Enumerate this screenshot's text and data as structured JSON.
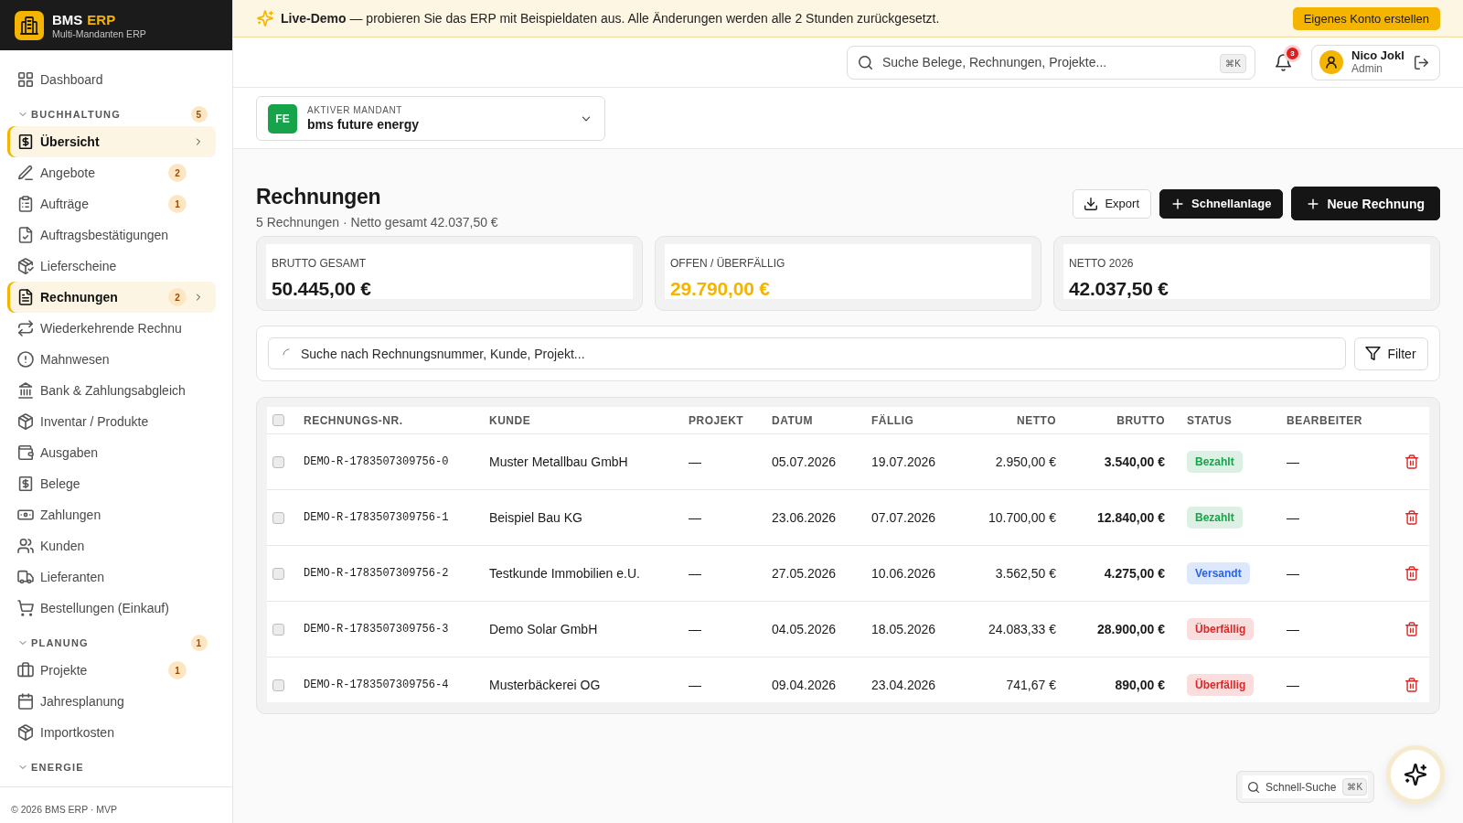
{
  "banner": {
    "message": "**Live-Demo** — probieren Sie das ERP mit Beispieldaten aus. Alle Änderungen werden alle 2 Stunden zurückgesetzt.",
    "button": "Eigenes Konto erstellen"
  },
  "sidebar": {
    "brand": {
      "name": "BMS",
      "accent": "ERP",
      "subtitle": "Multi-Mandanten ERP"
    },
    "nav": [
      {
        "kind": "item",
        "label": "Dashboard",
        "selected": false
      },
      {
        "kind": "section",
        "label": "BUCHHALTUNG",
        "badge": "5",
        "expanded": true,
        "children": [
          {
            "label": "Übersicht",
            "selected": true
          },
          {
            "label": "Angebote",
            "badge": "2",
            "selected": false
          },
          {
            "label": "Aufträge",
            "badge": "1",
            "selected": false
          },
          {
            "label": "Auftragsbestätigungen",
            "selected": false
          },
          {
            "label": "Lieferscheine",
            "selected": false
          },
          {
            "label": "Rechnungen",
            "badge": "2",
            "selected": true
          },
          {
            "label": "Wiederkehrende Rechnu",
            "selected": false
          },
          {
            "label": "Mahnwesen",
            "selected": false
          },
          {
            "label": "Bank & Zahlungsabgleich",
            "selected": false
          },
          {
            "label": "Inventar / Produkte",
            "selected": false
          },
          {
            "label": "Ausgaben",
            "selected": false
          },
          {
            "label": "Belege",
            "selected": false
          },
          {
            "label": "Zahlungen",
            "selected": false
          },
          {
            "label": "Kunden",
            "selected": false
          },
          {
            "label": "Lieferanten",
            "selected": false
          },
          {
            "label": "Bestellungen (Einkauf)",
            "selected": false
          }
        ]
      },
      {
        "kind": "section",
        "label": "PLANUNG",
        "badge": "1",
        "expanded": true,
        "children": [
          {
            "label": "Projekte",
            "badge": "1",
            "selected": false
          },
          {
            "label": "Jahresplanung",
            "selected": false
          },
          {
            "label": "Importkosten",
            "selected": false
          }
        ]
      },
      {
        "kind": "section",
        "label": "ENERGIE",
        "expanded": true
      }
    ],
    "footer": "© 2026 BMS ERP · MVP"
  },
  "topbar": {
    "search": {
      "placeholder": "Suche Belege, Rechnungen, Projekte...",
      "shortcut": "⌘K"
    },
    "notifications": {
      "count": "3"
    },
    "user": {
      "name": "Nico Jokl",
      "role": "Admin"
    }
  },
  "mandant": {
    "initials": "FE",
    "label": "AKTIVER MANDANT",
    "name": "bms future energy"
  },
  "page": {
    "title": "Rechnungen",
    "subtitle": "5 Rechnungen · Netto gesamt 42.037,50 €",
    "actions": [
      {
        "kind": "outline",
        "label": "Export"
      },
      {
        "kind": "dark",
        "label": "Schnellanlage"
      },
      {
        "kind": "primary",
        "label": "Neue Rechnung"
      }
    ]
  },
  "stats": [
    {
      "label": "BRUTTO GESAMT",
      "value": "50.445,00 €",
      "kind": "default"
    },
    {
      "label": "OFFEN / ÜBERFÄLLIG",
      "value": "29.790,00 €",
      "kind": "warning"
    },
    {
      "label": "NETTO 2026",
      "value": "42.037,50 €",
      "kind": "default"
    }
  ],
  "filter": {
    "search": {
      "placeholder": "Suche nach Rechnungsnummer, Kunde, Projekt..."
    },
    "button": "Filter"
  },
  "table": {
    "select_all": {
      "checked": false
    },
    "columns": [
      "RECHNUNGS-NR.",
      "KUNDE",
      "PROJEKT",
      "DATUM",
      "FÄLLIG",
      "NETTO",
      "BRUTTO",
      "STATUS",
      "BEARBEITER"
    ],
    "rows": [
      {
        "checked": false,
        "number": "DEMO-R-1783507309756-0",
        "customer": "Muster Metallbau GmbH",
        "project": "—",
        "date": "05.07.2026",
        "due": "19.07.2026",
        "net": "2.950,00 €",
        "gross": "3.540,00 €",
        "status": {
          "label": "Bezahlt",
          "color": "#16a34a"
        },
        "editor": "—"
      },
      {
        "checked": false,
        "number": "DEMO-R-1783507309756-1",
        "customer": "Beispiel Bau KG",
        "project": "—",
        "date": "23.06.2026",
        "due": "07.07.2026",
        "net": "10.700,00 €",
        "gross": "12.840,00 €",
        "status": {
          "label": "Bezahlt",
          "color": "#16a34a"
        },
        "editor": "—"
      },
      {
        "checked": false,
        "number": "DEMO-R-1783507309756-2",
        "customer": "Testkunde Immobilien e.U.",
        "project": "—",
        "date": "27.05.2026",
        "due": "10.06.2026",
        "net": "3.562,50 €",
        "gross": "4.275,00 €",
        "status": {
          "label": "Versandt",
          "color": "#2563eb"
        },
        "editor": "—"
      },
      {
        "checked": false,
        "number": "DEMO-R-1783507309756-3",
        "customer": "Demo Solar GmbH",
        "project": "—",
        "date": "04.05.2026",
        "due": "18.05.2026",
        "net": "24.083,33 €",
        "gross": "28.900,00 €",
        "status": {
          "label": "Überfällig",
          "color": "#dc2626"
        },
        "editor": "—"
      },
      {
        "checked": false,
        "number": "DEMO-R-1783507309756-4",
        "customer": "Musterbäckerei OG",
        "project": "—",
        "date": "09.04.2026",
        "due": "23.04.2026",
        "net": "741,67 €",
        "gross": "890,00 €",
        "status": {
          "label": "Überfällig",
          "color": "#dc2626"
        },
        "editor": "—"
      }
    ]
  },
  "quick_search": {
    "label": "Schnell-Suche",
    "shortcut": "⌘K"
  }
}
